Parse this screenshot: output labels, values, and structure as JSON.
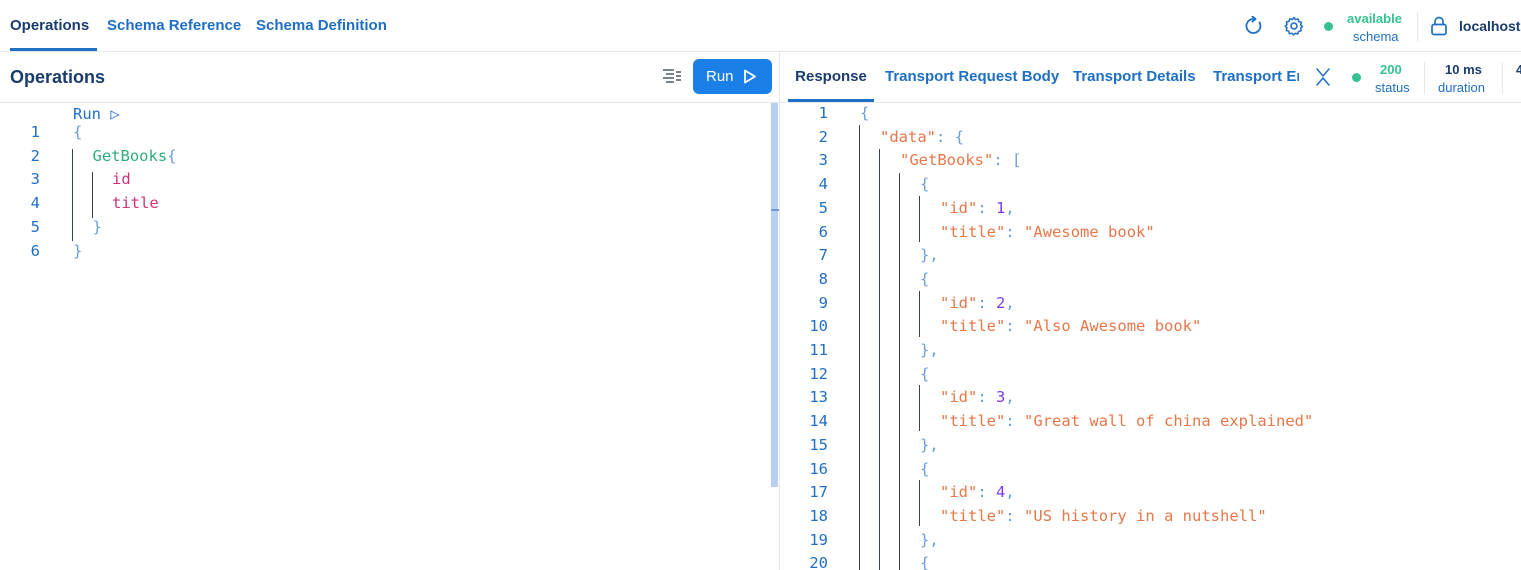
{
  "top_tabs": [
    {
      "label": "Operations",
      "active": true
    },
    {
      "label": "Schema Reference",
      "active": false
    },
    {
      "label": "Schema Definition",
      "active": false
    }
  ],
  "schema_status": {
    "value": "available",
    "label": "schema",
    "color": "#34c38f"
  },
  "server": {
    "label": "localhost:"
  },
  "operations_pane": {
    "title": "Operations",
    "run_button": "Run",
    "codelens": "Run ▷",
    "lines": [
      {
        "n": "1",
        "tokens": [
          {
            "t": "{",
            "c": "#6a9fd8"
          }
        ]
      },
      {
        "n": "2",
        "tokens": [
          {
            "t": "GetBooks",
            "c": "#2fae7a"
          },
          {
            "t": "{",
            "c": "#6a9fd8"
          }
        ]
      },
      {
        "n": "3",
        "tokens": [
          {
            "t": "id",
            "c": "#d0327a"
          }
        ]
      },
      {
        "n": "4",
        "tokens": [
          {
            "t": "title",
            "c": "#d0327a"
          }
        ]
      },
      {
        "n": "5",
        "tokens": [
          {
            "t": "}",
            "c": "#6a9fd8"
          }
        ]
      },
      {
        "n": "6",
        "tokens": [
          {
            "t": "}",
            "c": "#6a9fd8"
          }
        ]
      }
    ]
  },
  "response_pane": {
    "tabs": [
      {
        "label": "Response",
        "active": true
      },
      {
        "label": "Transport Request Body",
        "active": false
      },
      {
        "label": "Transport Details",
        "active": false
      },
      {
        "label": "Transport Er",
        "active": false
      }
    ],
    "status": {
      "value": "200",
      "label": "status"
    },
    "duration": {
      "value": "10 ms",
      "label": "duration"
    },
    "overflow_value": "4",
    "lines": [
      {
        "n": "1",
        "tokens": [
          {
            "t": "{",
            "c": "#6a9fd8"
          }
        ]
      },
      {
        "n": "2",
        "tokens": [
          {
            "t": "\"data\"",
            "c": "#e8774a"
          },
          {
            "t": ": {",
            "c": "#6a9fd8"
          }
        ]
      },
      {
        "n": "3",
        "tokens": [
          {
            "t": "\"GetBooks\"",
            "c": "#e8774a"
          },
          {
            "t": ": [",
            "c": "#6a9fd8"
          }
        ]
      },
      {
        "n": "4",
        "tokens": [
          {
            "t": "{",
            "c": "#6a9fd8"
          }
        ]
      },
      {
        "n": "5",
        "tokens": [
          {
            "t": "\"id\"",
            "c": "#e8774a"
          },
          {
            "t": ": ",
            "c": "#6a9fd8"
          },
          {
            "t": "1",
            "c": "#7c3aed"
          },
          {
            "t": ",",
            "c": "#6a9fd8"
          }
        ]
      },
      {
        "n": "6",
        "tokens": [
          {
            "t": "\"title\"",
            "c": "#e8774a"
          },
          {
            "t": ": ",
            "c": "#6a9fd8"
          },
          {
            "t": "\"Awesome book\"",
            "c": "#e8774a"
          }
        ]
      },
      {
        "n": "7",
        "tokens": [
          {
            "t": "},",
            "c": "#6a9fd8"
          }
        ]
      },
      {
        "n": "8",
        "tokens": [
          {
            "t": "{",
            "c": "#6a9fd8"
          }
        ]
      },
      {
        "n": "9",
        "tokens": [
          {
            "t": "\"id\"",
            "c": "#e8774a"
          },
          {
            "t": ": ",
            "c": "#6a9fd8"
          },
          {
            "t": "2",
            "c": "#7c3aed"
          },
          {
            "t": ",",
            "c": "#6a9fd8"
          }
        ]
      },
      {
        "n": "10",
        "tokens": [
          {
            "t": "\"title\"",
            "c": "#e8774a"
          },
          {
            "t": ": ",
            "c": "#6a9fd8"
          },
          {
            "t": "\"Also Awesome book\"",
            "c": "#e8774a"
          }
        ]
      },
      {
        "n": "11",
        "tokens": [
          {
            "t": "},",
            "c": "#6a9fd8"
          }
        ]
      },
      {
        "n": "12",
        "tokens": [
          {
            "t": "{",
            "c": "#6a9fd8"
          }
        ]
      },
      {
        "n": "13",
        "tokens": [
          {
            "t": "\"id\"",
            "c": "#e8774a"
          },
          {
            "t": ": ",
            "c": "#6a9fd8"
          },
          {
            "t": "3",
            "c": "#7c3aed"
          },
          {
            "t": ",",
            "c": "#6a9fd8"
          }
        ]
      },
      {
        "n": "14",
        "tokens": [
          {
            "t": "\"title\"",
            "c": "#e8774a"
          },
          {
            "t": ": ",
            "c": "#6a9fd8"
          },
          {
            "t": "\"Great wall of china explained\"",
            "c": "#e8774a"
          }
        ]
      },
      {
        "n": "15",
        "tokens": [
          {
            "t": "},",
            "c": "#6a9fd8"
          }
        ]
      },
      {
        "n": "16",
        "tokens": [
          {
            "t": "{",
            "c": "#6a9fd8"
          }
        ]
      },
      {
        "n": "17",
        "tokens": [
          {
            "t": "\"id\"",
            "c": "#e8774a"
          },
          {
            "t": ": ",
            "c": "#6a9fd8"
          },
          {
            "t": "4",
            "c": "#7c3aed"
          },
          {
            "t": ",",
            "c": "#6a9fd8"
          }
        ]
      },
      {
        "n": "18",
        "tokens": [
          {
            "t": "\"title\"",
            "c": "#e8774a"
          },
          {
            "t": ": ",
            "c": "#6a9fd8"
          },
          {
            "t": "\"US history in a nutshell\"",
            "c": "#e8774a"
          }
        ]
      },
      {
        "n": "19",
        "tokens": [
          {
            "t": "},",
            "c": "#6a9fd8"
          }
        ]
      },
      {
        "n": "20",
        "tokens": [
          {
            "t": "{",
            "c": "#6a9fd8"
          }
        ]
      }
    ]
  },
  "icons": {
    "refresh": "refresh-icon",
    "settings": "gear-icon",
    "lock": "lock-icon",
    "prettify": "prettify-icon",
    "run": "play-icon",
    "collapse": "collapse-icon"
  }
}
